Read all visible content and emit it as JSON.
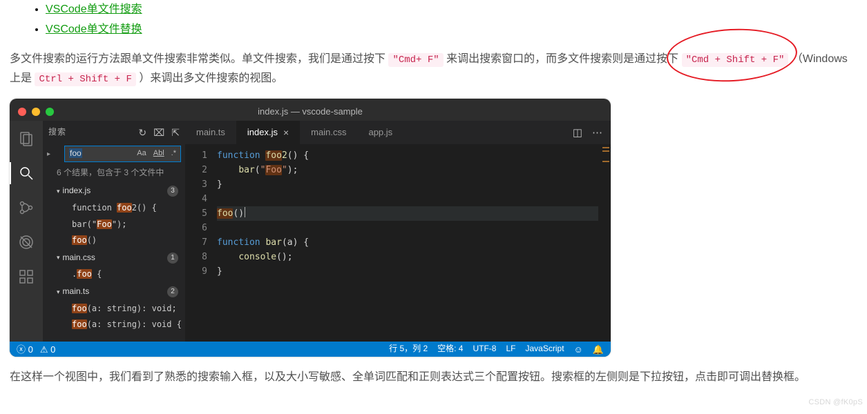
{
  "links": [
    "VSCode单文件搜索",
    "VSCode单文件替换"
  ],
  "para1_a": "多文件搜索的运行方法跟单文件搜索非常类似。单文件搜索，我们是通过按下 ",
  "para1_kbd1": "\"Cmd+ F\"",
  "para1_b": " 来调出搜索窗口的，而多文件搜索则是通过按下 ",
  "para1_kbd2": "\"Cmd + Shift + F\"",
  "para1_c": " （Windows 上是 ",
  "para1_kbd3": "Ctrl + Shift + F",
  "para1_d": " ）来调出多文件搜索的视图。",
  "window_title": "index.js — vscode-sample",
  "sidebar": {
    "title": "搜索",
    "query": "foo",
    "opts": {
      "case": "Aa",
      "word": "Abl",
      "regex": ".*"
    },
    "summary": "6 个结果，包含于 3 个文件中",
    "files": [
      {
        "name": "index.js",
        "count": "3",
        "matches": [
          {
            "pre": "function ",
            "hit": "foo",
            "post": "2() {"
          },
          {
            "pre": "bar(\"",
            "hit": "Foo",
            "post": "\");"
          },
          {
            "pre": "",
            "hit": "foo",
            "post": "()"
          }
        ]
      },
      {
        "name": "main.css",
        "count": "1",
        "matches": [
          {
            "pre": ".",
            "hit": "foo",
            "post": " {"
          }
        ]
      },
      {
        "name": "main.ts",
        "count": "2",
        "matches": [
          {
            "pre": "",
            "hit": "foo",
            "post": "(a: string): void;"
          },
          {
            "pre": "",
            "hit": "foo",
            "post": "(a: string): void {"
          }
        ]
      }
    ]
  },
  "tabs": [
    "main.ts",
    "index.js",
    "main.css",
    "app.js"
  ],
  "active_tab": 1,
  "code": {
    "lines": [
      {
        "n": "1",
        "html": "<span class='kw'>function</span> <span class='fn'><span class='m2'>foo</span>2</span>() {"
      },
      {
        "n": "2",
        "html": "    <span class='fn'>bar</span>(<span class='str'>\"<span class='m2'>Foo</span>\"</span>);"
      },
      {
        "n": "3",
        "html": "}"
      },
      {
        "n": "4",
        "html": ""
      },
      {
        "n": "5",
        "html": "<span class='fn'><span class='m2'>foo</span></span>()<span class='cursor'></span>",
        "hl": true
      },
      {
        "n": "6",
        "html": ""
      },
      {
        "n": "7",
        "html": "<span class='kw'>function</span> <span class='fn'>bar</span>(a) {"
      },
      {
        "n": "8",
        "html": "    <span class='fn'>console</span>();"
      },
      {
        "n": "9",
        "html": "}"
      }
    ]
  },
  "status": {
    "errors": "0",
    "warnings": "0",
    "pos": "行 5，列 2",
    "spaces": "空格: 4",
    "enc": "UTF-8",
    "eol": "LF",
    "lang": "JavaScript"
  },
  "para2": "在这样一个视图中，我们看到了熟悉的搜索输入框，以及大小写敏感、全单词匹配和正则表达式三个配置按钮。搜索框的左侧则是下拉按钮，点击即可调出替换框。",
  "watermark": "CSDN @fK0pS"
}
